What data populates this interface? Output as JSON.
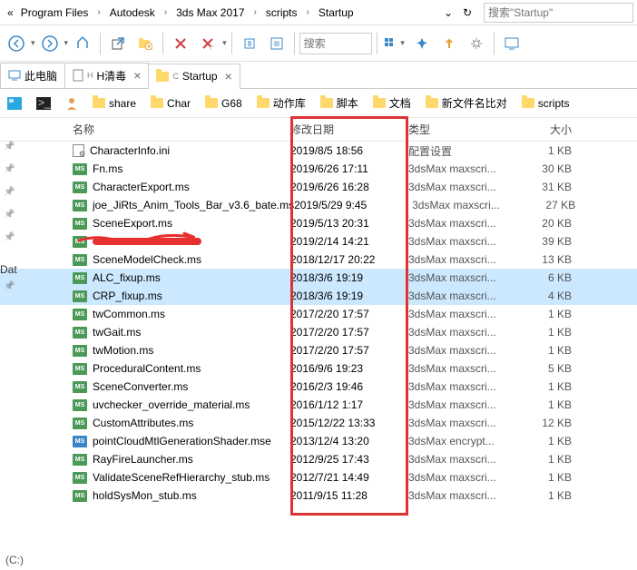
{
  "breadcrumb": {
    "prefix": "«",
    "items": [
      "Program Files",
      "Autodesk",
      "3ds Max 2017",
      "scripts",
      "Startup"
    ],
    "search_placeholder": "搜索\"Startup\""
  },
  "toolbar": {
    "search_placeholder": "搜索"
  },
  "tabs": [
    {
      "label": "此电脑",
      "closable": false,
      "icon": "pc"
    },
    {
      "label": "H清毒",
      "closable": true,
      "icon": "file"
    },
    {
      "label": "Startup",
      "closable": true,
      "icon": "folder",
      "active": true
    }
  ],
  "favorites": [
    {
      "label": "",
      "icon": "desktop"
    },
    {
      "label": "",
      "icon": "cmd"
    },
    {
      "label": "",
      "icon": "user"
    },
    {
      "label": "share",
      "icon": "folder"
    },
    {
      "label": "Char",
      "icon": "folder"
    },
    {
      "label": "G68",
      "icon": "folder"
    },
    {
      "label": "动作库",
      "icon": "folder"
    },
    {
      "label": "脚本",
      "icon": "folder"
    },
    {
      "label": "文档",
      "icon": "folder"
    },
    {
      "label": "新文件名比对",
      "icon": "folder"
    },
    {
      "label": "scripts",
      "icon": "folder"
    }
  ],
  "columns": {
    "name": "名称",
    "date": "修改日期",
    "type": "类型",
    "size": "大小"
  },
  "files": [
    {
      "name": "CharacterInfo.ini",
      "date": "2019/8/5 18:56",
      "type": "配置设置",
      "size": "1 KB",
      "icon": "ini"
    },
    {
      "name": "Fn.ms",
      "date": "2019/6/26 17:11",
      "type": "3dsMax maxscri...",
      "size": "30 KB",
      "icon": "ms"
    },
    {
      "name": "CharacterExport.ms",
      "date": "2019/6/26 16:28",
      "type": "3dsMax maxscri...",
      "size": "31 KB",
      "icon": "ms"
    },
    {
      "name": "joe_JiRts_Anim_Tools_Bar_v3.6_bate.ms",
      "date": "2019/5/29 9:45",
      "type": "3dsMax maxscri...",
      "size": "27 KB",
      "icon": "ms"
    },
    {
      "name": "SceneExport.ms",
      "date": "2019/5/13 20:31",
      "type": "3dsMax maxscri...",
      "size": "20 KB",
      "icon": "ms"
    },
    {
      "name": "[REDACTED]",
      "date": "2019/2/14 14:21",
      "type": "3dsMax maxscri...",
      "size": "39 KB",
      "icon": "ms",
      "redacted": true
    },
    {
      "name": "SceneModelCheck.ms",
      "date": "2018/12/17 20:22",
      "type": "3dsMax maxscri...",
      "size": "13 KB",
      "icon": "ms"
    },
    {
      "name": "ALC_fixup.ms",
      "date": "2018/3/6 19:19",
      "type": "3dsMax maxscri...",
      "size": "6 KB",
      "icon": "ms",
      "selected": true
    },
    {
      "name": "CRP_fixup.ms",
      "date": "2018/3/6 19:19",
      "type": "3dsMax maxscri...",
      "size": "4 KB",
      "icon": "ms",
      "selected": true
    },
    {
      "name": "twCommon.ms",
      "date": "2017/2/20 17:57",
      "type": "3dsMax maxscri...",
      "size": "1 KB",
      "icon": "ms"
    },
    {
      "name": "twGait.ms",
      "date": "2017/2/20 17:57",
      "type": "3dsMax maxscri...",
      "size": "1 KB",
      "icon": "ms"
    },
    {
      "name": "twMotion.ms",
      "date": "2017/2/20 17:57",
      "type": "3dsMax maxscri...",
      "size": "1 KB",
      "icon": "ms"
    },
    {
      "name": "ProceduralContent.ms",
      "date": "2016/9/6 19:23",
      "type": "3dsMax maxscri...",
      "size": "5 KB",
      "icon": "ms"
    },
    {
      "name": "SceneConverter.ms",
      "date": "2016/2/3 19:46",
      "type": "3dsMax maxscri...",
      "size": "1 KB",
      "icon": "ms"
    },
    {
      "name": "uvchecker_override_material.ms",
      "date": "2016/1/12 1:17",
      "type": "3dsMax maxscri...",
      "size": "1 KB",
      "icon": "ms"
    },
    {
      "name": "CustomAttributes.ms",
      "date": "2015/12/22 13:33",
      "type": "3dsMax maxscri...",
      "size": "12 KB",
      "icon": "ms"
    },
    {
      "name": "pointCloudMtlGenerationShader.mse",
      "date": "2013/12/4 13:20",
      "type": "3dsMax encrypt...",
      "size": "1 KB",
      "icon": "mse"
    },
    {
      "name": "RayFireLauncher.ms",
      "date": "2012/9/25 17:43",
      "type": "3dsMax maxscri...",
      "size": "1 KB",
      "icon": "ms"
    },
    {
      "name": "ValidateSceneRefHierarchy_stub.ms",
      "date": "2012/7/21 14:49",
      "type": "3dsMax maxscri...",
      "size": "1 KB",
      "icon": "ms"
    },
    {
      "name": "holdSysMon_stub.ms",
      "date": "2011/9/15 11:28",
      "type": "3dsMax maxscri...",
      "size": "1 KB",
      "icon": "ms"
    }
  ],
  "status": "(C:)"
}
